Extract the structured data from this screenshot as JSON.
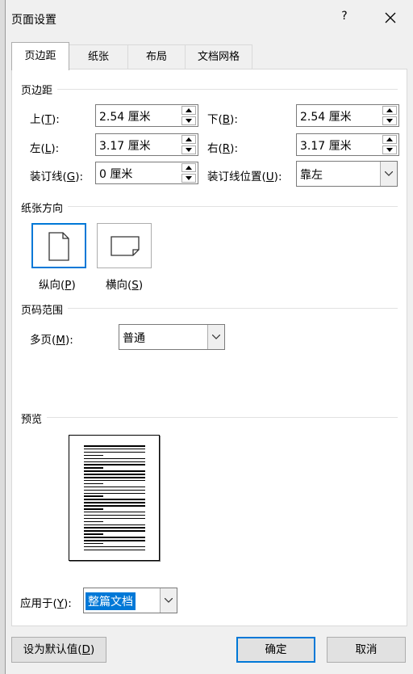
{
  "dialog": {
    "title": "页面设置",
    "help": "?",
    "close": "close"
  },
  "tabs": [
    {
      "label": "页边距",
      "active": true
    },
    {
      "label": "纸张"
    },
    {
      "label": "布局"
    },
    {
      "label": "文档网格"
    }
  ],
  "margins": {
    "section": "页边距",
    "top": {
      "label": "上",
      "key": "T",
      "value": "2.54 厘米"
    },
    "bottom": {
      "label": "下",
      "key": "B",
      "value": "2.54 厘米"
    },
    "left": {
      "label": "左",
      "key": "L",
      "value": "3.17 厘米"
    },
    "right": {
      "label": "右",
      "key": "R",
      "value": "3.17 厘米"
    },
    "gutter": {
      "label": "装订线",
      "key": "G",
      "value": "0 厘米"
    },
    "gutter_pos": {
      "label": "装订线位置",
      "key": "U",
      "value": "靠左"
    }
  },
  "orientation": {
    "section": "纸张方向",
    "portrait": {
      "label": "纵向",
      "key": "P",
      "selected": true
    },
    "landscape": {
      "label": "横向",
      "key": "S"
    }
  },
  "pages": {
    "section": "页码范围",
    "multiple": {
      "label": "多页",
      "key": "M",
      "value": "普通"
    }
  },
  "preview": {
    "section": "预览"
  },
  "apply_to": {
    "label": "应用于",
    "key": "Y",
    "value": "整篇文档"
  },
  "buttons": {
    "set_default": {
      "label": "设为默认值",
      "key": "D"
    },
    "ok": "确定",
    "cancel": "取消"
  },
  "colors": {
    "accent": "#0078d7",
    "selection": "#0078d7"
  }
}
